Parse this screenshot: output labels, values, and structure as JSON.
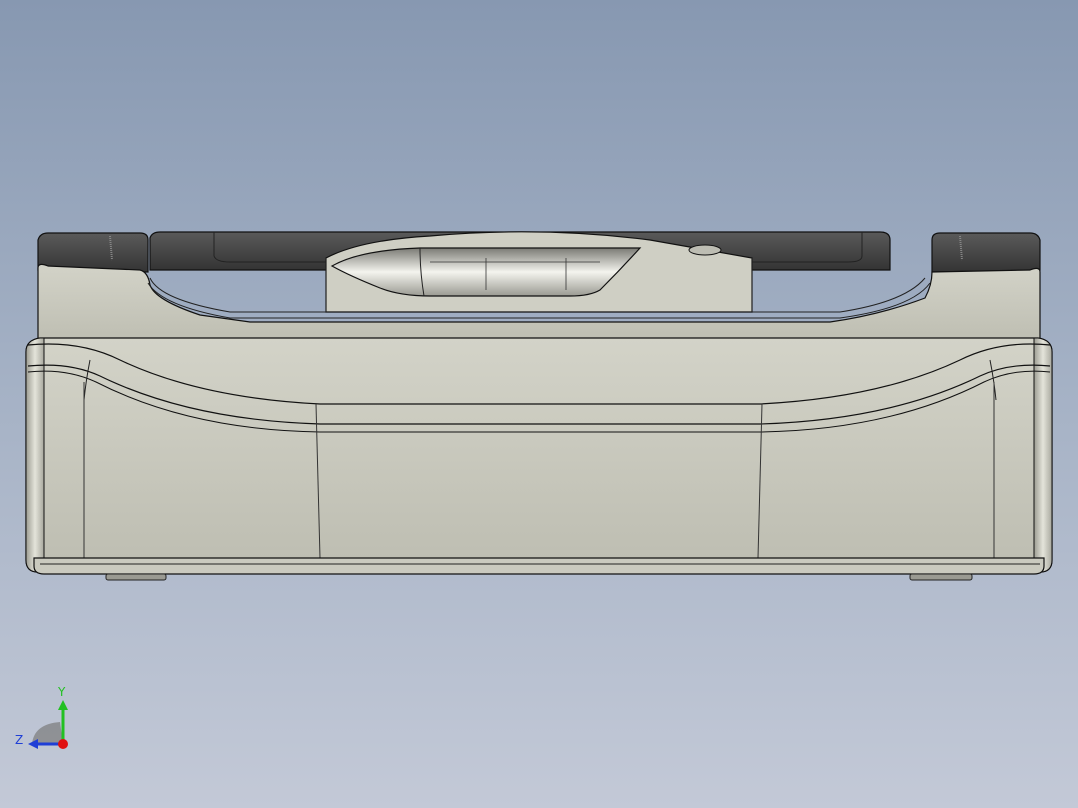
{
  "viewport": {
    "background_top": "#8798b1",
    "background_bottom": "#c3c9d7"
  },
  "model": {
    "body_color": "#c9c9bd",
    "edge_color": "#141414",
    "cap_color": "#4a4a4a"
  },
  "triad": {
    "y_label": "Y",
    "z_label": "Z",
    "y_color": "#22c022",
    "z_color": "#1f3fd6",
    "x_color": "#e01010"
  }
}
